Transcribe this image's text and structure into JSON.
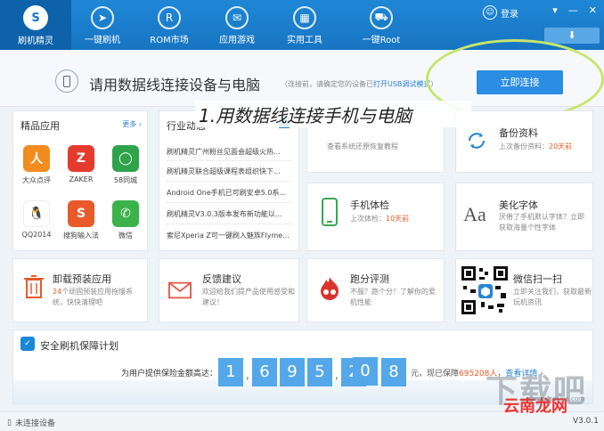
{
  "nav": {
    "items": [
      {
        "label": "刷机精灵",
        "icon": "logo-icon"
      },
      {
        "label": "一键刷机",
        "icon": "cursor-icon"
      },
      {
        "label": "ROM市场",
        "icon": "rom-icon"
      },
      {
        "label": "应用游戏",
        "icon": "mail-icon"
      },
      {
        "label": "实用工具",
        "icon": "grid-icon"
      },
      {
        "label": "一键Root",
        "icon": "car-icon"
      }
    ],
    "login": "登录",
    "win_controls": [
      "▾",
      "—",
      "✕"
    ]
  },
  "connect": {
    "title": "请用数据线连接设备与电脑",
    "sub_prefix": "（连接前，请确定您的设备已",
    "sub_link": "打开USB调试模式",
    "sub_suffix": "）",
    "button": "立即连接"
  },
  "annotation": "1.用数据线连接手机与电脑",
  "apps": {
    "title": "精品应用",
    "more": "更多 ›",
    "items": [
      {
        "label": "大众点评",
        "color": "#f28c1e",
        "glyph": "人"
      },
      {
        "label": "ZAKER",
        "color": "#e53b2f",
        "glyph": "Z"
      },
      {
        "label": "58同城",
        "color": "#2fa34a",
        "glyph": "◯"
      },
      {
        "label": "QQ2014",
        "color": "#ffffff",
        "glyph": "🐧"
      },
      {
        "label": "搜狗输入法",
        "color": "#e85a2a",
        "glyph": "S"
      },
      {
        "label": "微信",
        "color": "#3bb24a",
        "glyph": "✆"
      }
    ]
  },
  "news": {
    "title": "行业动态",
    "items": [
      "刷机精灵广州粉丝见面会超级火热...",
      "刷机精灵联合超级课程表组织快下...",
      "Android One手机已可刷安卓5.0系...",
      "刷机精灵V3.0.3版本发布新功能以...",
      "索尼Xperia Z可一键刷入魅族Flyme..."
    ]
  },
  "features": {
    "restore": {
      "desc": "查看系统还原恢复教程"
    },
    "backup": {
      "title": "备份资料",
      "desc_prefix": "上次备份资料：",
      "desc_value": "20天前"
    },
    "checkup": {
      "title": "手机体检",
      "desc_prefix": "上次体检：",
      "desc_value": "10天前"
    },
    "font": {
      "title": "美化字体",
      "desc": "厌倦了手机默认字体？立即获取海量个性字体"
    },
    "uninstall": {
      "title": "卸载预装应用",
      "desc_value": "24",
      "desc_suffix": "个顽固预装应用拖慢系统，快快清理吧"
    },
    "feedback": {
      "title": "反馈建议",
      "desc": "欢迎给我们提产品使用感受和建议！"
    },
    "benchmark": {
      "title": "跑分评测",
      "desc": "不服？跑个分！了解你的爱机性能"
    },
    "wechat": {
      "title": "微信扫一扫",
      "desc": "立即关注我们，获取最新玩机资讯"
    }
  },
  "plan": {
    "title": "安全刷机保障计划",
    "label": "为用户提供保险金额高达：",
    "digits": [
      "1",
      "6",
      "9",
      "5",
      "2",
      "0",
      "8"
    ],
    "suffix_prefix": "元，现已保障",
    "suffix_value": "695208人",
    "suffix_sep": "，",
    "link": "查看详情 ›"
  },
  "status": {
    "text": "未连接设备",
    "version": "V3.0.1"
  },
  "watermark": {
    "main": "下载吧",
    "sub": "www.xiazaiba.com",
    "cn": "云南龙网"
  }
}
